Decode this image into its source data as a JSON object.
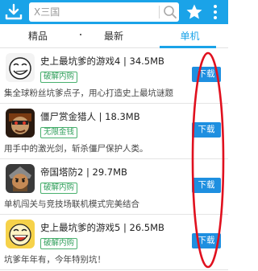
{
  "header": {
    "search_placeholder": "X三国",
    "colors": {
      "bar": "#1aa3e8",
      "accent": "#1aa3e8",
      "download": "#1e8fe0",
      "badge": "#2f9e5a",
      "annotation": "#e0101e"
    }
  },
  "tabs": [
    {
      "label": "精品"
    },
    {
      "label": "最新"
    },
    {
      "label": "单机",
      "active": true
    }
  ],
  "apps": [
    {
      "title": "史上最坑爹的游戏4 | 34.5MB",
      "badge": "破解内购",
      "desc": "集全球粉丝坑爹点子，用心打造史上最坑谜题",
      "button": "下载"
    },
    {
      "title": "僵尸赏金猎人 | 18.3MB",
      "badge": "无限金钱",
      "desc": "用手中的激光剑，斩杀僵尸保护人类。",
      "button": "下载"
    },
    {
      "title": "帝国塔防2 | 29.7MB",
      "badge": "破解内购",
      "desc": "单机闯关与竞技场联机模式完美结合",
      "button": "下载"
    },
    {
      "title": "史上最坑爹的游戏5 | 26.5MB",
      "badge": "破解内购",
      "desc": "坑爹年年有，今年特别坑！",
      "button": "下载"
    }
  ]
}
